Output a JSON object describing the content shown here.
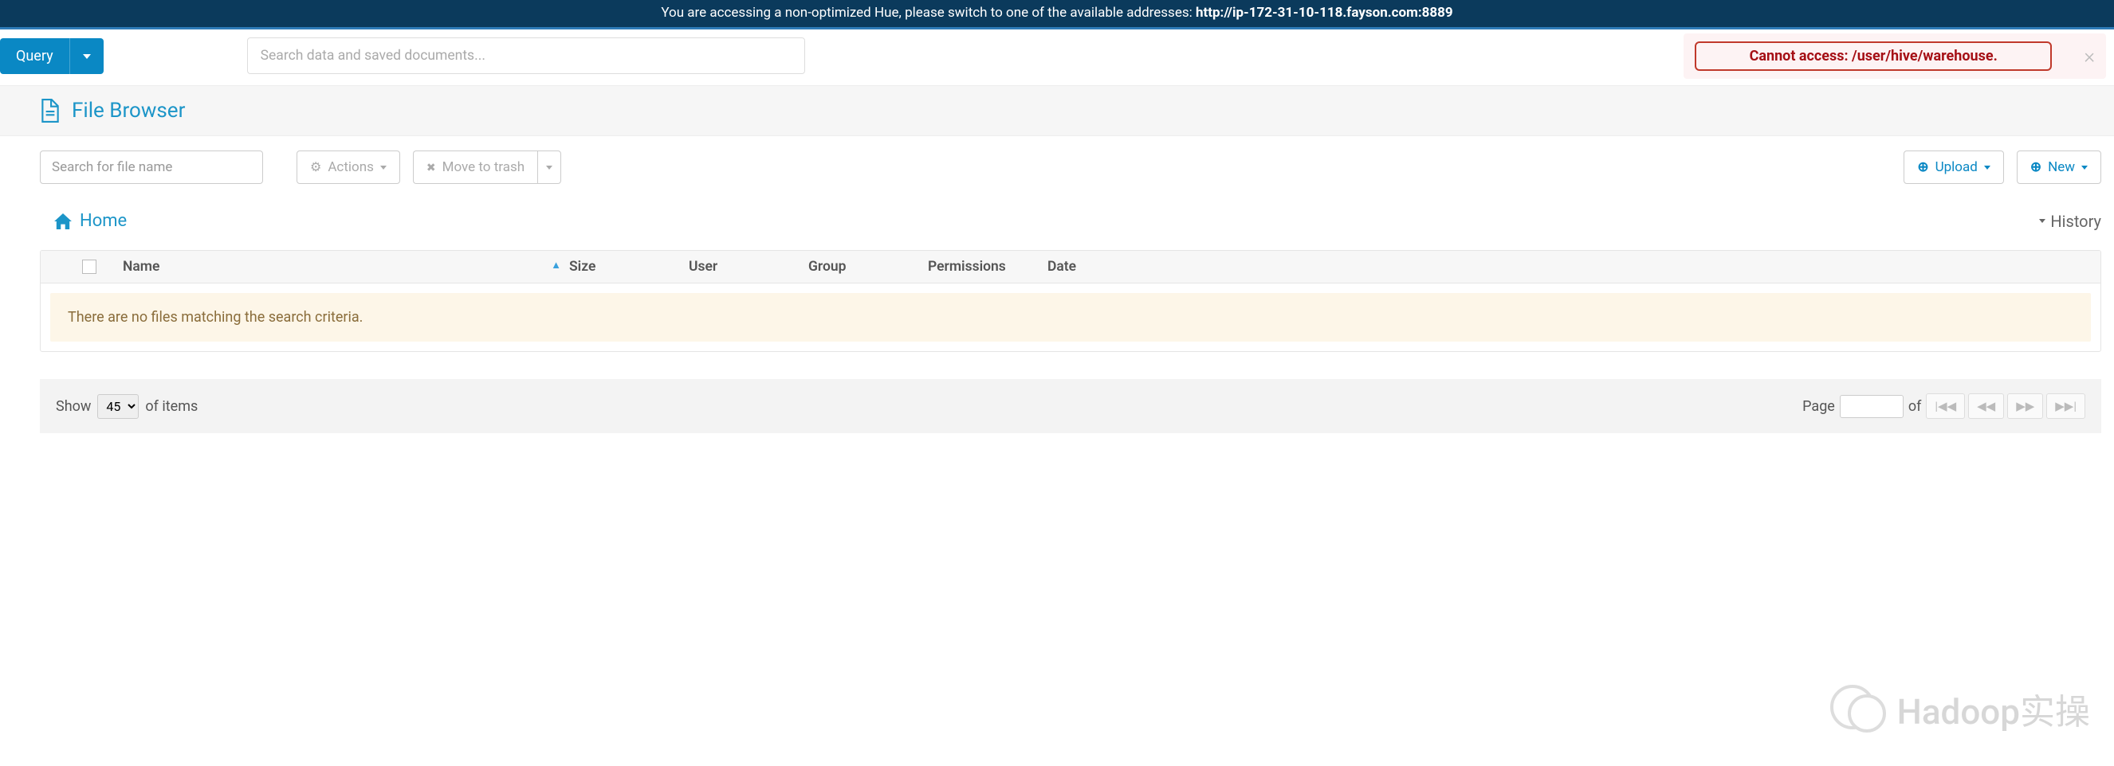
{
  "banner": {
    "text_before": "You are accessing a non-optimized Hue, please switch to one of the available addresses: ",
    "address": "http://ip-172-31-10-118.fayson.com:8889"
  },
  "toolbar": {
    "query_label": "Query",
    "search_placeholder": "Search data and saved documents..."
  },
  "alert": {
    "message": "Cannot access: /user/hive/warehouse."
  },
  "page": {
    "title": "File Browser"
  },
  "actions": {
    "file_search_placeholder": "Search for file name",
    "actions_label": "Actions",
    "move_trash_label": "Move to trash",
    "upload_label": "Upload",
    "new_label": "New"
  },
  "breadcrumb": {
    "home_label": "Home",
    "history_label": "History"
  },
  "table": {
    "headers": {
      "name": "Name",
      "size": "Size",
      "user": "User",
      "group": "Group",
      "permissions": "Permissions",
      "date": "Date"
    },
    "empty_message": "There are no files matching the search criteria."
  },
  "footer": {
    "show_label": "Show",
    "page_size": "45",
    "of_items_label": "of items",
    "page_label": "Page",
    "of_label": "of "
  },
  "watermark": {
    "text": "Hadoop实操"
  }
}
